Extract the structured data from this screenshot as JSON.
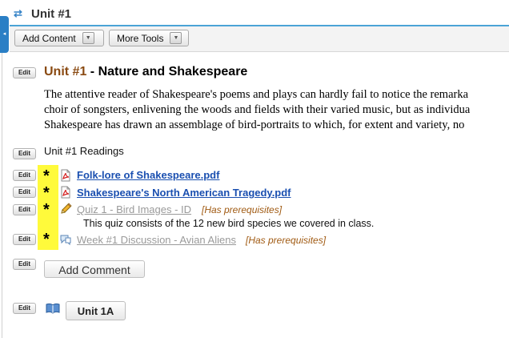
{
  "header": {
    "title": "Unit #1",
    "sync_icon": "refresh-icon",
    "accent_color": "#4aa3d6"
  },
  "toolbar": {
    "add_content_label": "Add Content",
    "more_tools_label": "More Tools"
  },
  "edit_label": "Edit",
  "unit": {
    "heading_accent": "Unit #1",
    "heading_rest": " - Nature and Shakespeare",
    "description_lines": [
      "The attentive reader of Shakespeare's poems and plays can hardly fail to notice the remarka",
      "choir of songsters, enlivening the woods and fields with their varied music, but as individua",
      "Shakespeare has drawn an assemblage of bird-portraits to which, for extent and variety, no"
    ]
  },
  "readings": {
    "label": "Unit #1 Readings"
  },
  "items": [
    {
      "title": "Folk-lore of Shakespeare.pdf",
      "icon": "pdf-icon",
      "state": "active",
      "marker": "*"
    },
    {
      "title": "Shakespeare's North American Tragedy.pdf",
      "icon": "pdf-icon",
      "state": "active",
      "marker": "*"
    },
    {
      "title": "Quiz 1 - Bird Images - ID",
      "icon": "pencil-icon",
      "state": "inactive",
      "marker": "*",
      "prerequisite": "[Has prerequisites]",
      "description": "This quiz consists of the 12 new bird species we covered in class."
    },
    {
      "title": "Week #1 Discussion - Avian Aliens",
      "icon": "discussion-icon",
      "state": "inactive",
      "marker": "*",
      "prerequisite": "[Has prerequisites]"
    }
  ],
  "comment": {
    "button_label": "Add Comment"
  },
  "subunit": {
    "icon": "book-icon",
    "label": "Unit 1A"
  },
  "colors": {
    "link": "#1a4fb0",
    "inactive_link": "#9a9a9a",
    "prereq": "#a05a12",
    "highlight": "#fffa3b",
    "heading_accent": "#8a4a12"
  }
}
